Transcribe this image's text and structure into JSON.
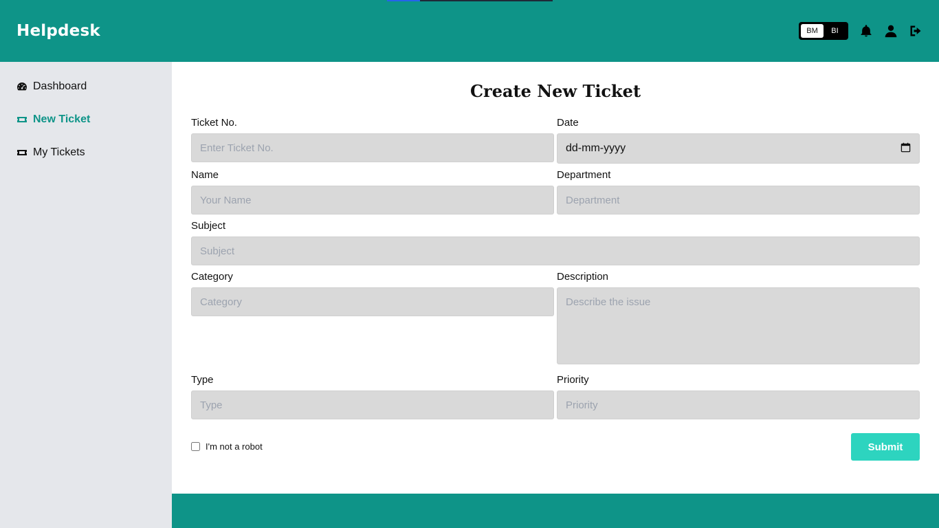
{
  "app": {
    "title": "Helpdesk"
  },
  "header": {
    "lang_options": [
      "BM",
      "BI"
    ],
    "active_lang": "BM",
    "icons": [
      "bell-icon",
      "user-icon",
      "logout-icon"
    ]
  },
  "sidebar": {
    "items": [
      {
        "label": "Dashboard",
        "icon": "dashboard-icon",
        "active": false
      },
      {
        "label": "New Ticket",
        "icon": "ticket-icon",
        "active": true
      },
      {
        "label": "My Tickets",
        "icon": "ticket-icon",
        "active": false
      }
    ]
  },
  "form": {
    "title": "Create New Ticket",
    "ticket_no": {
      "label": "Ticket No.",
      "placeholder": "Enter Ticket No.",
      "value": ""
    },
    "date": {
      "label": "Date",
      "value": "dd-mm-yyyy"
    },
    "name": {
      "label": "Name",
      "placeholder": "Your Name",
      "value": ""
    },
    "department": {
      "label": "Department",
      "placeholder": "Department",
      "value": ""
    },
    "subject": {
      "label": "Subject",
      "placeholder": "Subject",
      "value": ""
    },
    "category": {
      "label": "Category",
      "placeholder": "Category",
      "value": ""
    },
    "description": {
      "label": "Description",
      "placeholder": "Describe the issue",
      "value": ""
    },
    "type": {
      "label": "Type",
      "placeholder": "Type",
      "value": ""
    },
    "priority": {
      "label": "Priority",
      "placeholder": "Priority",
      "value": ""
    },
    "captcha_label": "I'm not a robot",
    "captcha_checked": false,
    "submit_label": "Submit"
  },
  "colors": {
    "primary": "#0e9488",
    "accent": "#2dd4bf",
    "sidebar_bg": "#e5e7eb",
    "field_bg": "#d9d9d9"
  }
}
